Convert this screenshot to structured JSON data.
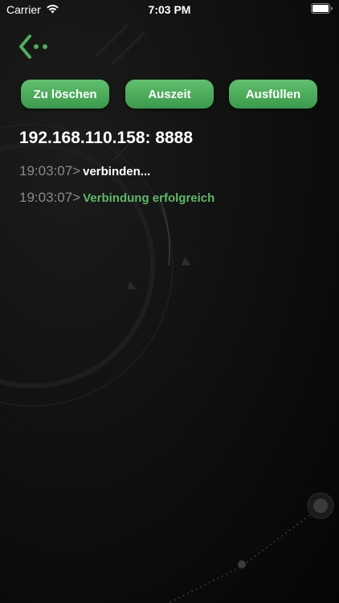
{
  "status_bar": {
    "carrier": "Carrier",
    "time": "7:03 PM",
    "wifi_icon": "wifi-icon",
    "battery_icon": "battery-icon"
  },
  "nav": {
    "back_icon": "back-arrow-dots-icon"
  },
  "actions": {
    "clear_label": "Zu löschen",
    "timeout_label": "Auszeit",
    "fill_label": "Ausfüllen"
  },
  "connection": {
    "address": "192.168.110.158: 8888"
  },
  "log": [
    {
      "time": "19:03:07>",
      "message": "verbinden..."
    },
    {
      "time": "19:03:07>",
      "message": "Verbindung erfolgreich"
    }
  ],
  "colors": {
    "accent": "#4caf5c",
    "success_text": "#5fb86a",
    "timestamp_text": "#8a8a8a",
    "background": "#111111"
  }
}
